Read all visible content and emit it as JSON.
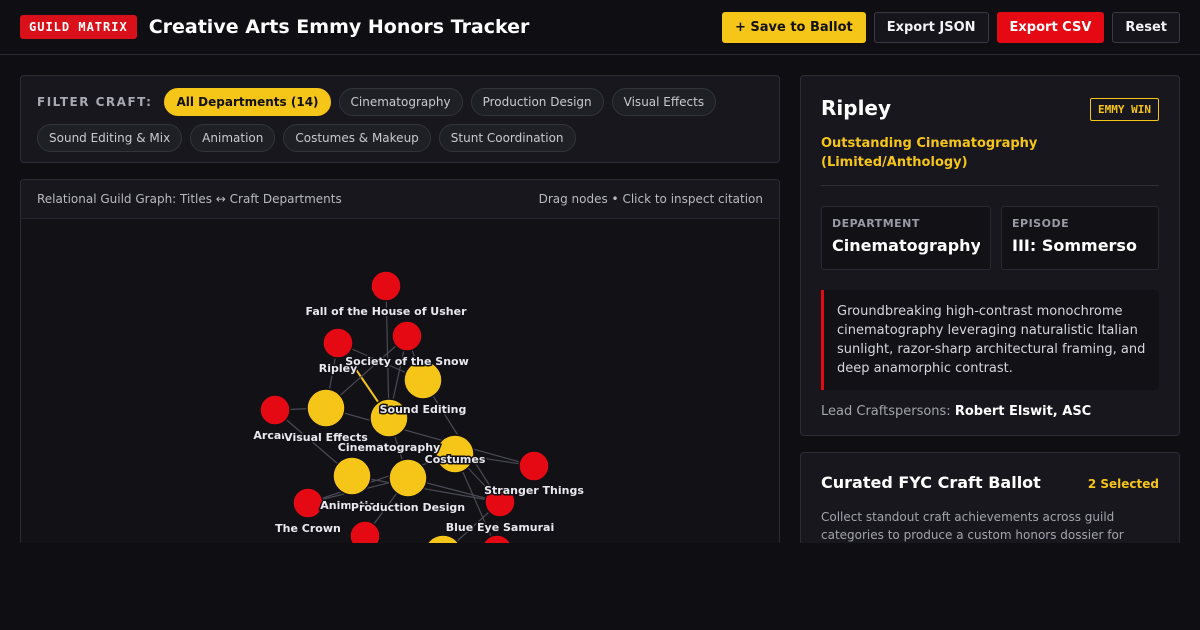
{
  "header": {
    "brand": "GUILD MATRIX",
    "title": "Creative Arts Emmy Honors Tracker",
    "save_label": "+ Save to Ballot",
    "export_json_label": "Export JSON",
    "export_csv_label": "Export CSV",
    "reset_label": "Reset"
  },
  "filter": {
    "label": "FILTER CRAFT:",
    "chips": [
      "All Departments (14)",
      "Cinematography",
      "Production Design",
      "Visual Effects",
      "Sound Editing & Mix",
      "Animation",
      "Costumes & Makeup",
      "Stunt Coordination"
    ],
    "active_index": 0
  },
  "graph": {
    "title": "Relational Guild Graph: Titles ↔ Craft Departments",
    "hint": "Drag nodes • Click to inspect citation",
    "colors": {
      "title_node": "#e50914",
      "dept_node": "#f5c518",
      "edge": "#4a4a55",
      "edge_active": "#f5c518"
    },
    "nodes": [
      {
        "id": "usher",
        "label": "Fall of the House of Usher",
        "kind": "title"
      },
      {
        "id": "ripley",
        "label": "Ripley",
        "kind": "title"
      },
      {
        "id": "snow",
        "label": "Society of the Snow",
        "kind": "title"
      },
      {
        "id": "sound",
        "label": "Sound Editing",
        "kind": "dept"
      },
      {
        "id": "arcane",
        "label": "Arcane",
        "kind": "title"
      },
      {
        "id": "vfx",
        "label": "Visual Effects",
        "kind": "dept"
      },
      {
        "id": "cine",
        "label": "Cinematography",
        "kind": "dept"
      },
      {
        "id": "costumes",
        "label": "Costumes",
        "kind": "dept"
      },
      {
        "id": "stranger",
        "label": "Stranger Things",
        "kind": "title"
      },
      {
        "id": "anim",
        "label": "Animation",
        "kind": "dept"
      },
      {
        "id": "prod",
        "label": "Production Design",
        "kind": "dept"
      },
      {
        "id": "crown",
        "label": "The Crown",
        "kind": "title"
      },
      {
        "id": "blueeye",
        "label": "Blue Eye Samurai",
        "kind": "title"
      },
      {
        "id": "t1",
        "label": "",
        "kind": "title"
      },
      {
        "id": "t2",
        "label": "",
        "kind": "title"
      },
      {
        "id": "d1",
        "label": "",
        "kind": "dept"
      }
    ],
    "edges": [
      [
        "ripley",
        "cine"
      ],
      [
        "ripley",
        "vfx"
      ],
      [
        "ripley",
        "sound"
      ],
      [
        "snow",
        "sound"
      ],
      [
        "snow",
        "vfx"
      ],
      [
        "snow",
        "cine"
      ],
      [
        "usher",
        "cine"
      ],
      [
        "arcane",
        "anim"
      ],
      [
        "arcane",
        "vfx"
      ],
      [
        "stranger",
        "costumes"
      ],
      [
        "stranger",
        "vfx"
      ],
      [
        "crown",
        "prod"
      ],
      [
        "crown",
        "costumes"
      ],
      [
        "blueeye",
        "anim"
      ],
      [
        "blueeye",
        "costumes"
      ],
      [
        "blueeye",
        "prod"
      ],
      [
        "t1",
        "prod"
      ],
      [
        "t2",
        "costumes"
      ],
      [
        "d1",
        "blueeye"
      ],
      [
        "sound",
        "blueeye"
      ],
      [
        "cine",
        "prod"
      ]
    ],
    "active_edge": [
      "ripley",
      "cine"
    ]
  },
  "detail": {
    "title": "Ripley",
    "badge": "EMMY WIN",
    "category": "Outstanding Cinematography (Limited/Anthology)",
    "department_label": "DEPARTMENT",
    "department_value": "Cinematography",
    "episode_label": "EPISODE",
    "episode_value": "III: Sommerso",
    "citation": "Groundbreaking high-contrast monochrome cinematography leveraging naturalistic Italian sunlight, razor-sharp architectural framing, and deep anamorphic contrast.",
    "lead_label": "Lead Craftspersons:",
    "lead_value": "Robert Elswit, ASC"
  },
  "ballot": {
    "title": "Curated FYC Craft Ballot",
    "count": "2 Selected",
    "description": "Collect standout craft achievements across guild categories to produce a custom honors dossier for"
  }
}
